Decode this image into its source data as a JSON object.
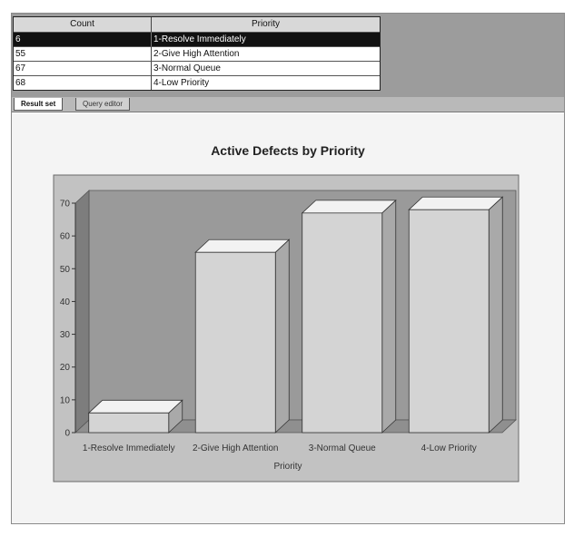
{
  "grid": {
    "columns": [
      "Count",
      "Priority"
    ],
    "rows": [
      {
        "count": "6",
        "priority": "1-Resolve Immediately"
      },
      {
        "count": "55",
        "priority": "2-Give High Attention"
      },
      {
        "count": "67",
        "priority": "3-Normal Queue"
      },
      {
        "count": "68",
        "priority": "4-Low Priority"
      }
    ],
    "selected_row": 0
  },
  "tabs": {
    "result": "Result set",
    "query": "Query editor"
  },
  "chart_data": {
    "type": "bar",
    "title": "Active Defects by Priority",
    "xlabel": "Priority",
    "ylabel": "",
    "categories": [
      "1-Resolve Immediately",
      "2-Give High Attention",
      "3-Normal Queue",
      "4-Low Priority"
    ],
    "values": [
      6,
      55,
      67,
      68
    ],
    "ylim": [
      0,
      70
    ],
    "yticks": [
      0,
      10,
      20,
      30,
      40,
      50,
      60,
      70
    ],
    "style": "3d",
    "legend": "none",
    "colors": {
      "wall": "#9a9a9a",
      "floor": "#8f8f8f",
      "bar_front": "#d4d4d4",
      "bar_top": "#f2f2f2",
      "bar_side": "#a9a9a9",
      "plot_panel": "#c2c2c2"
    }
  }
}
